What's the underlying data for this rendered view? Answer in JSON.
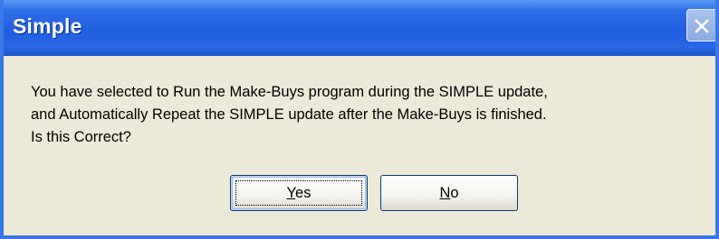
{
  "dialog": {
    "title": "Simple",
    "close_icon": "close-icon",
    "message_lines": [
      "You have selected to Run the Make-Buys program during the SIMPLE update,",
      "and Automatically Repeat the SIMPLE update after the Make-Buys is finished.",
      "Is this Correct?"
    ],
    "buttons": {
      "yes": {
        "label_mnemonic": "Y",
        "label_rest": "es"
      },
      "no": {
        "label_mnemonic": "N",
        "label_rest": "o"
      }
    },
    "colors": {
      "titlebar": "#1f5ee0",
      "frame": "#3a78e8",
      "body": "#ece9d8",
      "button_border": "#003c74"
    }
  }
}
